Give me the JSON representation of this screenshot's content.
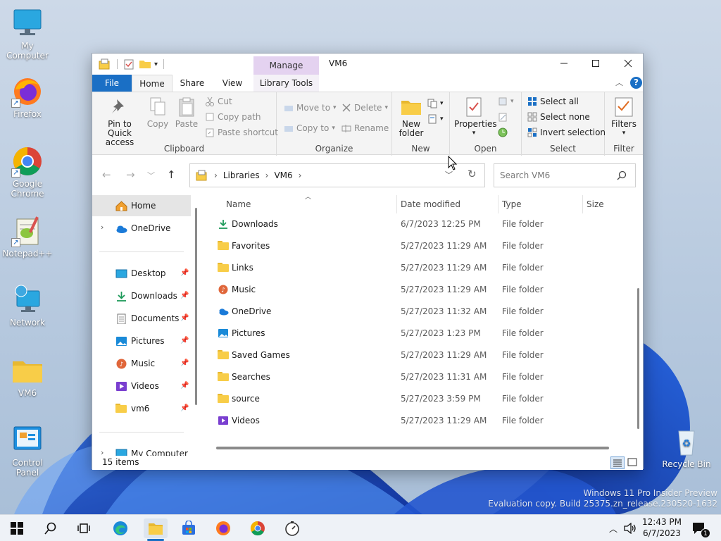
{
  "desktop": {
    "icons": [
      {
        "label": "My Computer",
        "icon": "monitor-icon"
      },
      {
        "label": "Firefox",
        "icon": "firefox-icon"
      },
      {
        "label": "Google Chrome",
        "icon": "chrome-icon"
      },
      {
        "label": "Notepad++",
        "icon": "notepadpp-icon"
      },
      {
        "label": "Network",
        "icon": "network-icon"
      },
      {
        "label": "VM6",
        "icon": "folder-icon"
      },
      {
        "label": "Control Panel",
        "icon": "control-panel-icon"
      }
    ],
    "recycle_bin": "Recycle Bin",
    "watermark": {
      "line1": "Windows 11 Pro Insider Preview",
      "line2": "Evaluation copy. Build 25375.zn_release.230520-1632"
    }
  },
  "window": {
    "title": "VM6",
    "manage_label": "Manage",
    "tabs": {
      "file": "File",
      "home": "Home",
      "share": "Share",
      "view": "View",
      "library_tools": "Library Tools"
    },
    "ribbon": {
      "clipboard": {
        "group_label": "Clipboard",
        "pin": "Pin to Quick access",
        "copy": "Copy",
        "paste": "Paste",
        "cut": "Cut",
        "copy_path": "Copy path",
        "paste_shortcut": "Paste shortcut"
      },
      "organize": {
        "group_label": "Organize",
        "move_to": "Move to",
        "copy_to": "Copy to",
        "delete": "Delete",
        "rename": "Rename"
      },
      "new": {
        "group_label": "New",
        "new_folder": "New folder"
      },
      "open": {
        "group_label": "Open",
        "properties": "Properties"
      },
      "select": {
        "group_label": "Select",
        "select_all": "Select all",
        "select_none": "Select none",
        "invert_selection": "Invert selection"
      },
      "filter": {
        "group_label": "Filter",
        "filters": "Filters"
      }
    },
    "address": {
      "crumbs": [
        "Libraries",
        "VM6"
      ],
      "search_placeholder": "Search VM6"
    },
    "nav": {
      "home": "Home",
      "onedrive": "OneDrive",
      "pinned": [
        {
          "label": "Desktop",
          "icon": "desktop-icon"
        },
        {
          "label": "Downloads",
          "icon": "downloads-icon"
        },
        {
          "label": "Documents",
          "icon": "documents-icon"
        },
        {
          "label": "Pictures",
          "icon": "pictures-icon"
        },
        {
          "label": "Music",
          "icon": "music-icon"
        },
        {
          "label": "Videos",
          "icon": "videos-icon"
        },
        {
          "label": "vm6",
          "icon": "folder-icon"
        }
      ],
      "my_computer": "My Computer"
    },
    "columns": {
      "name": "Name",
      "date": "Date modified",
      "type": "Type",
      "size": "Size"
    },
    "files": [
      {
        "name": "Downloads",
        "date": "6/7/2023 12:25 PM",
        "type": "File folder",
        "icon": "downloads-icon"
      },
      {
        "name": "Favorites",
        "date": "5/27/2023 11:29 AM",
        "type": "File folder",
        "icon": "folder-icon"
      },
      {
        "name": "Links",
        "date": "5/27/2023 11:29 AM",
        "type": "File folder",
        "icon": "folder-icon"
      },
      {
        "name": "Music",
        "date": "5/27/2023 11:29 AM",
        "type": "File folder",
        "icon": "music-icon"
      },
      {
        "name": "OneDrive",
        "date": "5/27/2023 11:32 AM",
        "type": "File folder",
        "icon": "onedrive-icon"
      },
      {
        "name": "Pictures",
        "date": "5/27/2023 1:23 PM",
        "type": "File folder",
        "icon": "pictures-icon"
      },
      {
        "name": "Saved Games",
        "date": "5/27/2023 11:29 AM",
        "type": "File folder",
        "icon": "folder-icon"
      },
      {
        "name": "Searches",
        "date": "5/27/2023 11:31 AM",
        "type": "File folder",
        "icon": "folder-icon"
      },
      {
        "name": "source",
        "date": "5/27/2023 3:59 PM",
        "type": "File folder",
        "icon": "folder-icon"
      },
      {
        "name": "Videos",
        "date": "5/27/2023 11:29 AM",
        "type": "File folder",
        "icon": "videos-icon"
      }
    ],
    "status": "15 items"
  },
  "taskbar": {
    "time": "12:43 PM",
    "date": "6/7/2023",
    "notification_count": "1"
  }
}
